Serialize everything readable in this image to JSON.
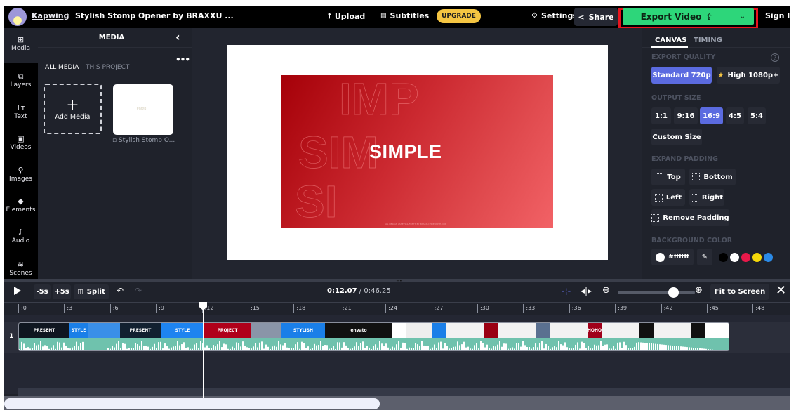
{
  "topbar": {
    "brand": "Kapwing",
    "separator": "›",
    "project_title": "Stylish Stomp Opener by BRAXXU ...",
    "upload": "Upload",
    "subtitles": "Subtitles",
    "upgrade": "UPGRADE",
    "settings": "Settings",
    "share": "Share",
    "export": "Export Video",
    "sign_in": "Sign In"
  },
  "rail": {
    "items": [
      {
        "label": "Media",
        "icon": "media-icon",
        "glyph": "⊞"
      },
      {
        "label": "Layers",
        "icon": "layers-icon",
        "glyph": "⧉"
      },
      {
        "label": "Text",
        "icon": "text-icon",
        "glyph": "Tт"
      },
      {
        "label": "Videos",
        "icon": "videos-icon",
        "glyph": "▣"
      },
      {
        "label": "Images",
        "icon": "images-icon",
        "glyph": "⚲"
      },
      {
        "label": "Elements",
        "icon": "elements-icon",
        "glyph": "◆"
      },
      {
        "label": "Audio",
        "icon": "audio-icon",
        "glyph": "♪"
      },
      {
        "label": "Scenes",
        "icon": "scenes-icon",
        "glyph": "≋"
      }
    ]
  },
  "media": {
    "title": "MEDIA",
    "tabs": [
      "ALL MEDIA",
      "THIS PROJECT"
    ],
    "add_media": "Add Media",
    "items": [
      {
        "label": "Stylish Stomp O...",
        "preview_text": "EMPR..."
      }
    ]
  },
  "canvas": {
    "outline_lines": [
      "IMP",
      "SIM",
      "SI"
    ],
    "headline": "SIMPLE",
    "footer_text": "ALL DESIGN ASSETS & FONTS BY BRAXXU-VIDEOHIVE.COM"
  },
  "props": {
    "tabs": [
      "CANVAS",
      "TIMING"
    ],
    "export_quality_label": "EXPORT QUALITY",
    "quality_options": [
      "Standard 720p",
      "High 1080p+"
    ],
    "quality_selected": "Standard 720p",
    "output_size_label": "OUTPUT SIZE",
    "sizes": [
      "1:1",
      "9:16",
      "16:9",
      "4:5",
      "5:4"
    ],
    "size_selected": "16:9",
    "custom_size": "Custom Size",
    "expand_padding_label": "EXPAND PADDING",
    "padding": [
      "Top",
      "Bottom",
      "Left",
      "Right",
      "Remove Padding"
    ],
    "background_color_label": "BACKGROUND COLOR",
    "background_color": "#ffffff",
    "swatches": [
      "#000000",
      "#ffffff",
      "#e8194a",
      "#f5d90a",
      "#2b8ae6"
    ]
  },
  "timeline": {
    "back5": "-5s",
    "fwd5": "+5s",
    "split": "Split",
    "current_time": "0:12.07",
    "total_time": "0:46.25",
    "fit_to_screen": "Fit to Screen",
    "zoom_level": 0.72,
    "ticks": [
      ":0",
      ":3",
      ":6",
      ":9",
      ":12",
      ":15",
      ":18",
      ":21",
      ":24",
      ":27",
      ":30",
      ":33",
      ":36",
      ":39",
      ":42",
      ":45",
      ":48"
    ],
    "track_number": "1",
    "clip_frames": [
      {
        "label": "PRESENT",
        "color": "#0f1620"
      },
      {
        "label": "STYLE",
        "color": "#1a7fe8"
      },
      {
        "label": "",
        "color": "#3a8fe8"
      },
      {
        "label": "PRESENT",
        "color": "#122030"
      },
      {
        "label": "STYLE",
        "color": "#1e84f0"
      },
      {
        "label": "PROJECT",
        "color": "#b0001a"
      },
      {
        "label": "",
        "color": "#8a95a8"
      },
      {
        "label": "STYLISH",
        "color": "#1a7fe8"
      },
      {
        "label": "envato",
        "color": "#111111"
      },
      {
        "label": "",
        "color": "#ffffff"
      },
      {
        "label": "",
        "color": "#eeeeee"
      },
      {
        "label": "",
        "color": "#1a7fe8"
      },
      {
        "label": "",
        "color": "#f2f2f2"
      },
      {
        "label": "",
        "color": "#9a0012"
      },
      {
        "label": "",
        "color": "#f2f2f2"
      },
      {
        "label": "",
        "color": "#5a7090"
      },
      {
        "label": "",
        "color": "#f2f2f2"
      },
      {
        "label": "HOHO",
        "color": "#a0001a"
      },
      {
        "label": "",
        "color": "#f2f2f2"
      },
      {
        "label": "",
        "color": "#111111"
      },
      {
        "label": "",
        "color": "#f2f2f2"
      },
      {
        "label": "",
        "color": "#111111"
      },
      {
        "label": "",
        "color": "#ffffff"
      }
    ]
  }
}
